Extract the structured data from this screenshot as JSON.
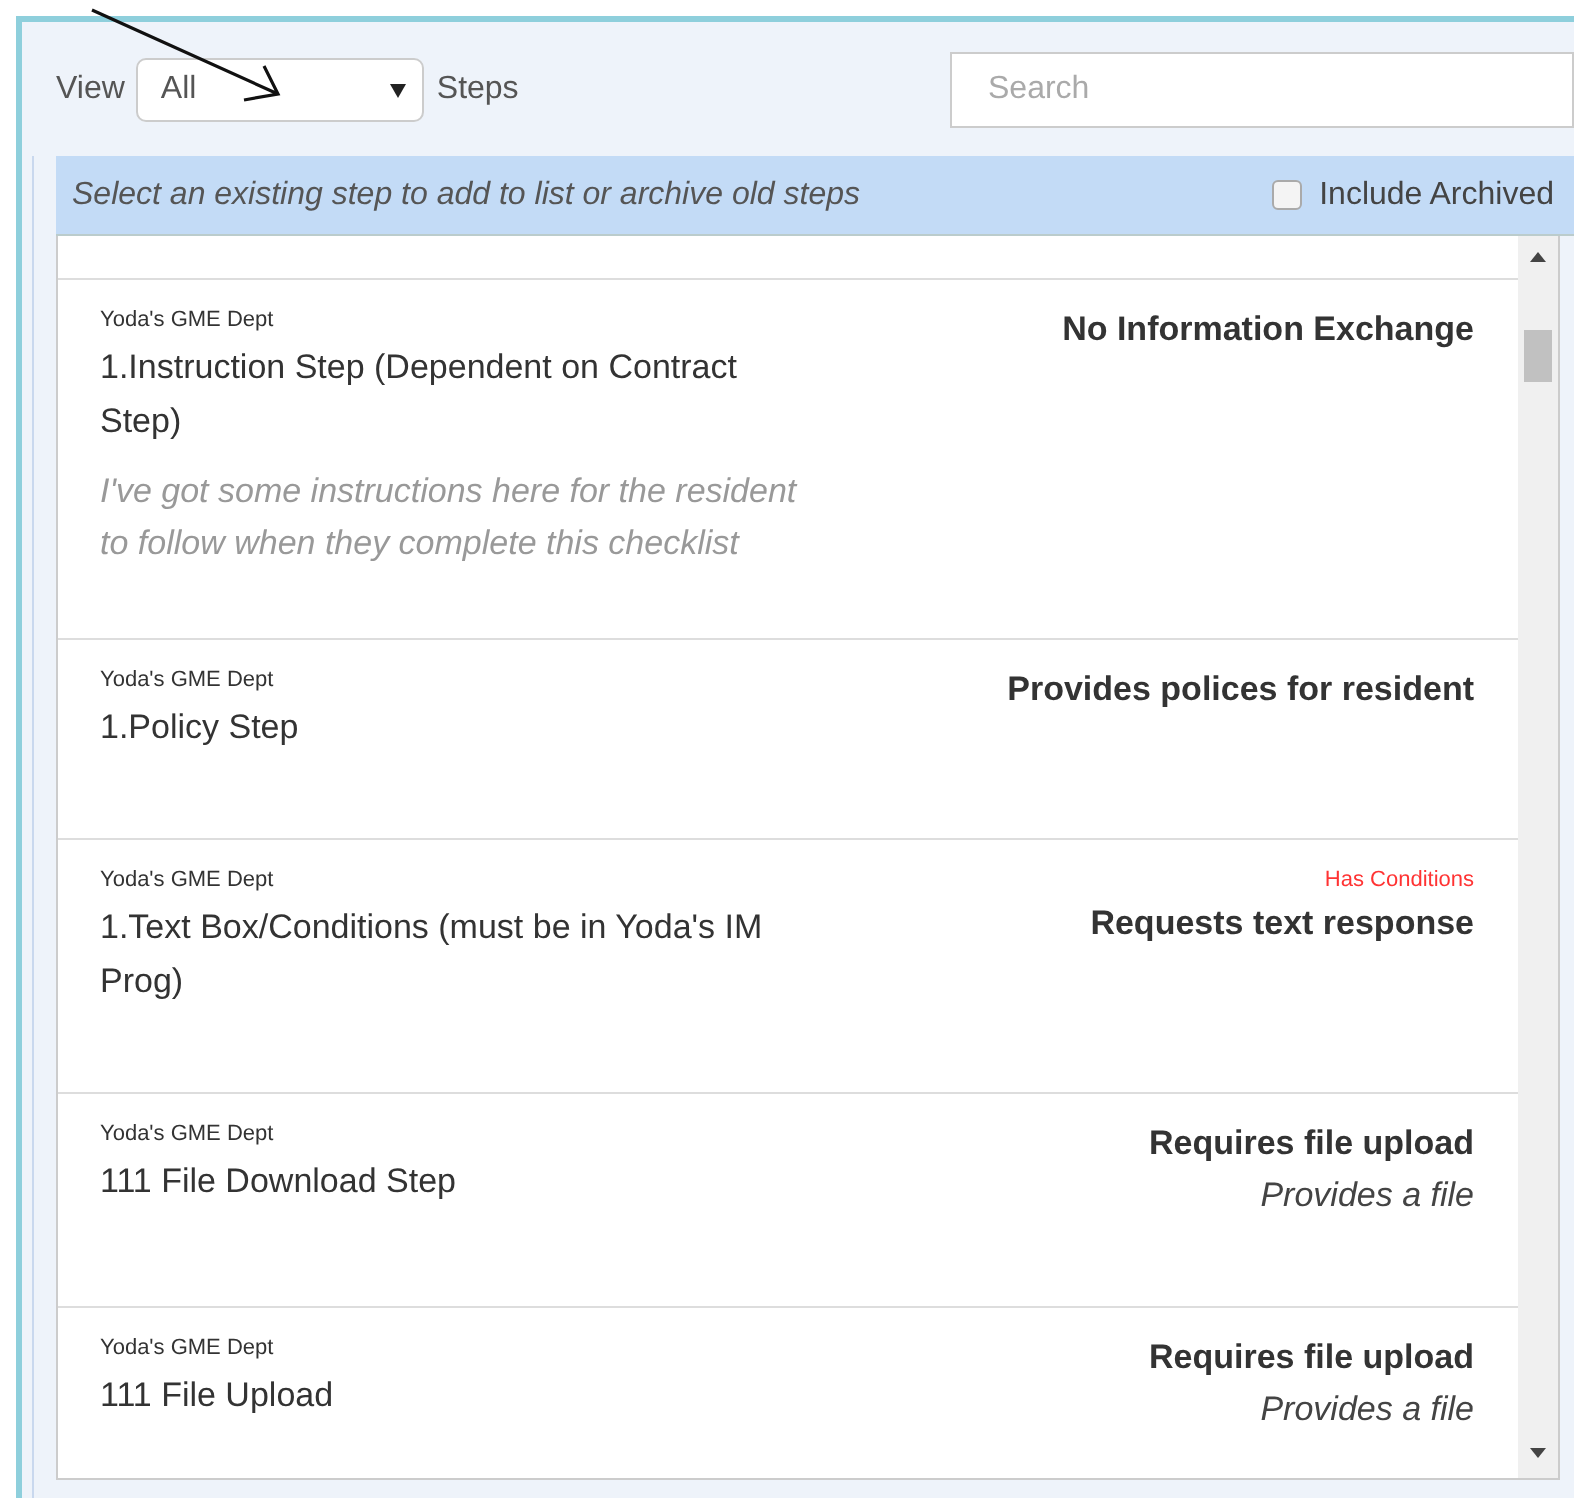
{
  "filter": {
    "label": "View",
    "value": "All",
    "suffix": "Steps"
  },
  "search": {
    "placeholder": "Search"
  },
  "banner": {
    "text": "Select an existing step to add to list or archive old steps",
    "include_archived": {
      "label": "Include Archived",
      "checked": false
    }
  },
  "steps": [
    {
      "dept": "Yoda's GME Dept",
      "title": "1.Instruction Step (Dependent on Contract Step)",
      "description": "I've got some instructions here for the resident to follow when they complete this checklist",
      "type": "No Information Exchange"
    },
    {
      "dept": "Yoda's GME Dept",
      "title": "1.Policy Step",
      "type": "Provides polices for resident"
    },
    {
      "dept": "Yoda's GME Dept",
      "title": "1.Text Box/Conditions (must be in Yoda's IM Prog)",
      "flag": "Has Conditions",
      "type": "Requests text response"
    },
    {
      "dept": "Yoda's GME Dept",
      "title": "111 File Download Step",
      "type": "Requires file upload",
      "subtype": "Provides a file"
    },
    {
      "dept": "Yoda's GME Dept",
      "title": "111 File Upload",
      "type": "Requires file upload",
      "subtype": "Provides a file"
    }
  ]
}
